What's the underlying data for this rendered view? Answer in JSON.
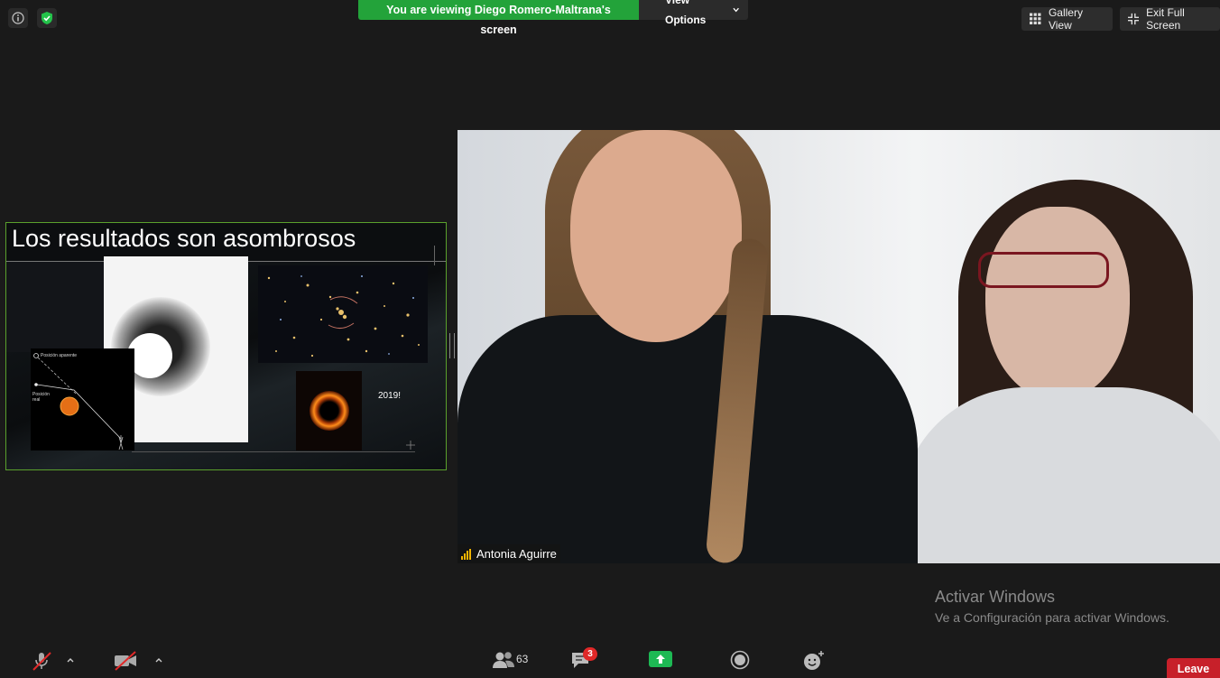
{
  "top": {
    "info_icon": "info-icon",
    "security_icon": "shield-check-icon",
    "banner_message": "You are viewing Diego Romero-Maltrana's screen",
    "view_options_label": "View Options",
    "gallery_view_label": "Gallery View",
    "exit_full_screen_label": "Exit Full Screen"
  },
  "shared_screen": {
    "slide_title": "Los resultados son asombrosos",
    "diagram_label_apparent": "Posición aparente",
    "diagram_label_real": "Posición real",
    "year_label": "2019!"
  },
  "video": {
    "participant_name": "Antonia Aguirre"
  },
  "watermark": {
    "title": "Activar Windows",
    "subtitle": "Ve a Configuración para activar Windows."
  },
  "toolbar": {
    "participants_count": "63",
    "chat_badge": "3",
    "leave_label": "Leave"
  },
  "colors": {
    "banner_green": "#23a33a",
    "leave_red": "#c7202a",
    "share_green": "#1db954",
    "slide_border": "#5aa02c"
  }
}
